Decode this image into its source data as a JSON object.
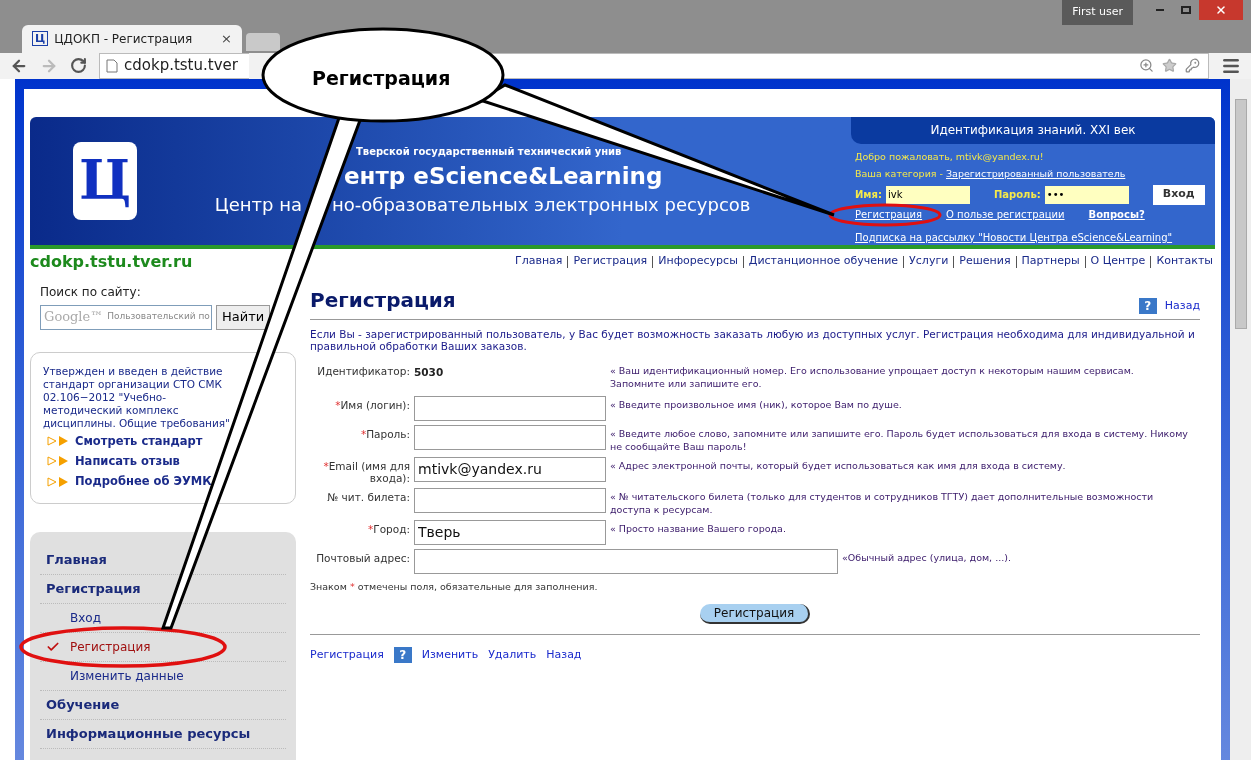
{
  "browser": {
    "tab_title": "ЦДОКП - Регистрация",
    "tab_icon": "Ц",
    "tab_close": "×",
    "user": "First user",
    "url": "cdokp.tstu.tver"
  },
  "callout": {
    "text": "Регистрация"
  },
  "header": {
    "logo": "Ц",
    "university": "Тверской государственный технический унив",
    "title": "ентр eScience&Learning",
    "subtitle_left": "Центр на",
    "subtitle_right": "но-образовательных электронных ресурсов",
    "panel_title": "Идентификация знаний. XXI век",
    "welcome": "Добро пожаловать, mtivk@yandex.ru!",
    "category_label": "Ваша категория -",
    "category": "Зарегистрированный пользователь",
    "name_label": "Имя:",
    "name_value": "ivk",
    "password_label": "Пароль:",
    "password_value": "•••",
    "login_button": "Вход",
    "links": [
      "Регистрация",
      "О пользе регистрации"
    ],
    "questions": "Вопросы?",
    "subscribe": "Подписка на рассылку \"Новости Центра eScience&Learning\""
  },
  "site_name": "cdokp.tstu.tver.ru",
  "nav": [
    "Главная",
    "Регистрация",
    "Инфоресурсы",
    "Дистанционное обучение",
    "Услуги",
    "Решения",
    "Партнеры",
    "О Центре",
    "Контакты"
  ],
  "search": {
    "label": "Поиск по сайту:",
    "brand": "Google™",
    "placeholder": "Пользовательский по",
    "button": "Найти"
  },
  "notice": {
    "text": "Утвержден и введен в действие стандарт организации СТО СМК 02.106−2012 \"Учебно-методический комплекс дисциплины. Общие требования\"",
    "links": [
      "Смотреть стандарт",
      "Написать отзыв",
      "Подробнее об ЭУМК"
    ]
  },
  "menu": [
    {
      "label": "Главная",
      "selected": false
    },
    {
      "label": "Регистрация",
      "selected": false,
      "children": [
        {
          "label": "Вход",
          "selected": false
        },
        {
          "label": "Регистрация",
          "selected": true
        },
        {
          "label": "Изменить данные",
          "selected": false
        }
      ]
    },
    {
      "label": "Обучение",
      "selected": false
    },
    {
      "label": "Информационные ресурсы",
      "selected": false
    }
  ],
  "main": {
    "title": "Регистрация",
    "help": "?",
    "back": "Назад",
    "intro": "Если Вы - зарегистрированный пользователь, у Вас будет возможность заказать любую из доступных услуг. Регистрация необходима для индивидуальной и правильной обработки Ваших заказов.",
    "fields": [
      {
        "kind": "static",
        "label": "Идентификатор:",
        "required": false,
        "value": "5030",
        "hint": "« Ваш идентификационный номер. Его использование упрощает доступ к некоторым нашим сервисам. Запомните или запишите его."
      },
      {
        "kind": "input",
        "label": "Имя (логин):",
        "required": true,
        "hint": "« Введите произвольное имя (ник), которое Вам по душе."
      },
      {
        "kind": "input",
        "label": "Пароль:",
        "required": true,
        "hint": "« Введите любое слово, запомните или запишите его. Пароль будет использоваться для входа в систему. Никому не сообщайте Ваш пароль!"
      },
      {
        "kind": "input",
        "label": "Email (имя для входа):",
        "required": true,
        "value": "mtivk@yandex.ru",
        "hint": "« Адрес электронной почты, который будет использоваться как имя для входа в систему."
      },
      {
        "kind": "input",
        "label": "№ чит. билета:",
        "required": false,
        "hint": "« № читательского билета (только для студентов и сотрудников ТГТУ) дает дополнительные возможности доступа к ресурсам."
      },
      {
        "kind": "input",
        "label": "Город:",
        "required": true,
        "value": "Тверь",
        "hint": "« Просто название Вашего города."
      },
      {
        "kind": "wide",
        "label": "Почтовый адрес:",
        "required": false,
        "hint": "«Обычный адрес (улица, дом, ...)."
      }
    ],
    "required_mark": "*",
    "note_before": "Знаком",
    "note_after": "отмечены поля, обязательные для заполнения.",
    "submit": "Регистрация",
    "footer_links": [
      {
        "kind": "link",
        "label": "Регистрация"
      },
      {
        "kind": "help",
        "label": "?"
      },
      {
        "kind": "link",
        "label": "Изменить"
      },
      {
        "kind": "link",
        "label": "Удалить"
      },
      {
        "kind": "link",
        "label": "Назад"
      }
    ]
  }
}
